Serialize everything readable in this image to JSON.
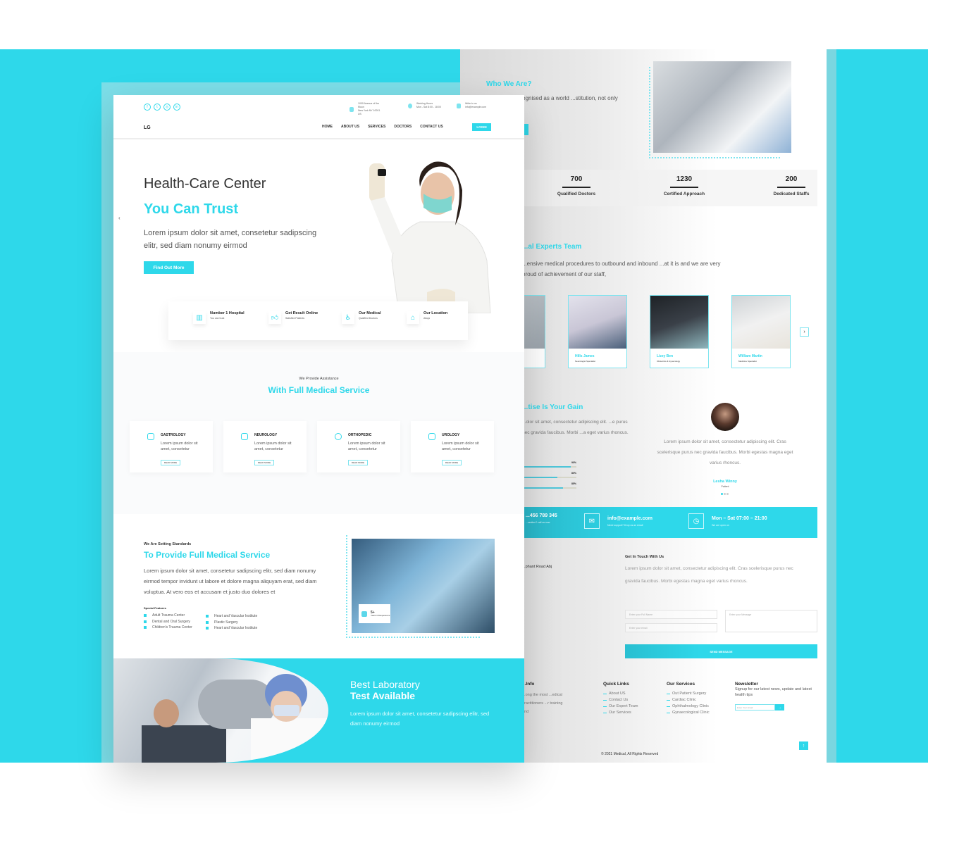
{
  "colors": {
    "brand": "#2ed8ea",
    "brand_light": "#7cdee8",
    "text": "#222222"
  },
  "header": {
    "social_icons": [
      "facebook-icon",
      "twitter-icon",
      "instagram-icon",
      "linkedin-icon"
    ],
    "info": [
      {
        "icon": "location-pin-icon",
        "line1": "1000 Avenue of the Moon",
        "line2": "New York NY 10001 US"
      },
      {
        "icon": "clock-icon",
        "line1": "Working Hours",
        "line2": "Mon - Sat 8:00 - 18:00"
      },
      {
        "icon": "mail-icon",
        "line1": "Write to us",
        "line2": "info@example.com"
      }
    ],
    "logo": "LG",
    "nav": [
      "HOME",
      "ABOUT US",
      "SERVICES",
      "DOCTORS",
      "CONTACT US"
    ],
    "login_label": "LOGIN"
  },
  "hero": {
    "title": "Health-Care Center",
    "subtitle": "You Can Trust",
    "description": "Lorem ipsum dolor sit amet, consetetur sadipscing elitr, sed diam nonumy eirmod",
    "cta_label": "Find Out More",
    "prev_arrow": "‹"
  },
  "features": [
    {
      "icon": "building-icon",
      "title": "Number 1 Hospital",
      "subtitle": "You can trust"
    },
    {
      "icon": "thumbs-up-icon",
      "title": "Get Result Online",
      "subtitle": "Satisfied Patients"
    },
    {
      "icon": "wheelchair-icon",
      "title": "Our Medical",
      "subtitle": "Qualified Doctors"
    },
    {
      "icon": "location-box-icon",
      "title": "Our Location",
      "subtitle": "Abuja"
    }
  ],
  "services": {
    "kicker": "We Provide Assistance",
    "title": "With Full Medical Service",
    "cards": [
      {
        "name": "GASTROLOGY",
        "description": "Lorem ipsum dolor sit amet, consetetur",
        "button": "READ MORE"
      },
      {
        "name": "NEUROLOGY",
        "description": "Lorem ipsum dolor sit amet, consetetur",
        "button": "READ MORE"
      },
      {
        "name": "ORTHOPEDIC",
        "description": "Lorem ipsum dolor sit amet, consetetur",
        "button": "READ MORE"
      },
      {
        "name": "UROLOGY",
        "description": "Lorem ipsum dolor sit amet, consetetur",
        "button": "READ MORE"
      }
    ]
  },
  "standards": {
    "kicker": "We Are Setting Standards",
    "title": "To Provide Full Medical Service",
    "description": "Lorem ipsum dolor sit amet, consetetur sadipscing elitr, sed diam nonumy eirmod tempor invidunt ut labore et dolore magna aliquyam erat, sed diam voluptua. At vero eos et accusam et justo duo dolores et",
    "features_title": "Special Features",
    "features_col1": [
      "Adult Trauma Center",
      "Dental and Oral Surgery",
      "Children's Trauma Center"
    ],
    "features_col2": [
      "Heart and Vascular Institute",
      "Plastic Surgery",
      "Heart and Vascular Institute"
    ],
    "badge": {
      "number": "5+",
      "label": "Years Of Experience"
    }
  },
  "lab": {
    "title_light": "Best Laboratory",
    "title_bold": "Test Available",
    "description": "Lorem ipsum dolor sit amet, consetetur sadipscing elitr, sed diam nonumy eirmod"
  },
  "about": {
    "title": "Who We Are?",
    "description": "...ospital is recognised as a world ...stitution, not only providing"
  },
  "stats": [
    {
      "value": "700",
      "label": "Qualified Doctors"
    },
    {
      "value": "1230",
      "label": "Certified Approach"
    },
    {
      "value": "200",
      "label": "Dedicated Staffs"
    }
  ],
  "team": {
    "title": "...al Experts Team",
    "description": "...ensive medical procedures to outbound and inbound ...at it is and we are very proud of achievement of our staff,",
    "doctors": [
      {
        "name": "Hills James",
        "role": "Neurologist Specialist"
      },
      {
        "name": "Lizzy Ben",
        "role": "Obstetrics & Gynecology"
      },
      {
        "name": "William Martin",
        "role": "Medicine Specialist"
      }
    ],
    "next_label": "›"
  },
  "gain": {
    "title": "...tise Is  Your Gain",
    "description": "...olor sit amet, consectetur adipiscing elit. ...e purus nec gravida faucibus. Morbi ...a eget varius rhoncus.",
    "bars": [
      {
        "label": "90%",
        "value": 90
      },
      {
        "label": "80%",
        "value": 65
      },
      {
        "label": "85%",
        "value": 75
      }
    ]
  },
  "testimonial": {
    "text": "Lorem ipsum dolor sit amet, consectetur adipiscing elit. Cras scelerisque purus nec gravida faucibus. Morbi egestas magna eget varius rhoncus.",
    "name": "Lesha Winny",
    "role": "Patient"
  },
  "contact_bar": [
    {
      "icon": "phone-icon",
      "main": "...456 789 345",
      "sub": "...uestion? call us now"
    },
    {
      "icon": "envelope-icon",
      "main": "info@example.com",
      "sub": "Need support? Drop us an email"
    },
    {
      "icon": "clock-icon",
      "main": "Mon – Sat 07:00 – 21:00",
      "sub": "We are open on"
    }
  ],
  "contact": {
    "address_fragment": "...phant Road Abj",
    "title": "Get In Touch With Us",
    "description": "Lorem ipsum dolor sit amet, consectetur adipiscing elit. Cras scelerisque purus nec gravida faucibus. Morbi egestas magna eget varius rhoncus.",
    "name_placeholder": "Enter your Full Name",
    "email_placeholder": "Enter your email",
    "message_placeholder": "Enter your Message",
    "send_label": "SEND MESSAGE"
  },
  "footer": {
    "info_title": "...Info",
    "info_text": "...ong the most ...edical practitioners ...r training and",
    "quick_links_title": "Quick Links",
    "quick_links": [
      "About US",
      "Contact Us",
      "Our Expert Team",
      "Our Services"
    ],
    "services_title": "Our Services",
    "services": [
      "Out Patient Surgery",
      "Cardiac Clinic",
      "Ophthalmology Clinic",
      "Gynaecological Clinic"
    ],
    "newsletter_title": "Newsletter",
    "newsletter_text": "Signup for our latest news, update and latest health tips",
    "newsletter_placeholder": "Enter Your Email",
    "newsletter_button": "→",
    "to_top": "↑",
    "copyright": "© 2021 Medical, All Rights Reserved"
  }
}
